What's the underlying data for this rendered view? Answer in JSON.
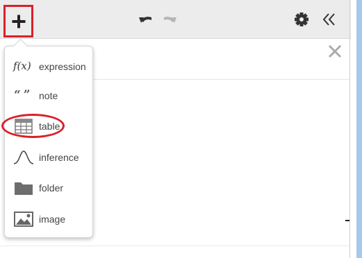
{
  "toolbar": {
    "add_icon": "plus-icon",
    "undo_icon": "undo-icon",
    "redo_icon": "redo-icon",
    "settings_icon": "gear-icon",
    "collapse_icon": "double-chevron-left-icon"
  },
  "expression_panel": {
    "close_icon": "close-icon"
  },
  "add_menu": {
    "items": [
      {
        "label": "expression",
        "icon": "fx-icon",
        "icon_text": "f(x)"
      },
      {
        "label": "note",
        "icon": "quote-icon",
        "icon_text": "“ ”"
      },
      {
        "label": "table",
        "icon": "table-icon"
      },
      {
        "label": "inference",
        "icon": "distribution-curve-icon"
      },
      {
        "label": "folder",
        "icon": "folder-icon"
      },
      {
        "label": "image",
        "icon": "image-icon"
      }
    ]
  },
  "colors": {
    "highlight": "#d9202a",
    "toolbar_bg": "#ececec",
    "graph_edge": "#a8c8ec"
  }
}
